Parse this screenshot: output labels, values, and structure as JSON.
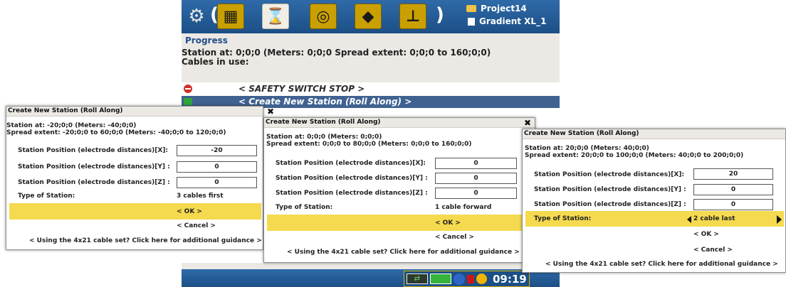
{
  "app": {
    "project_name": "Project14",
    "protocol_name": "Gradient XL_1",
    "progress_title": "Progress",
    "station_line": "Station at: 0;0;0 (Meters: 0;0;0 Spread extent: 0;0;0 to 160;0;0)",
    "cables_line": "Cables in use:",
    "safety_stop_label": "< SAFETY SWITCH STOP >",
    "create_station_label": "< Create New Station (Roll Along) >",
    "clock": "09:19",
    "toolbar_icons": [
      "gear-icon",
      "layers-icon",
      "hourglass-icon",
      "spiral-icon",
      "diamond-icon",
      "crane-icon"
    ]
  },
  "dialogs": [
    {
      "title": "Create New Station (Roll Along)",
      "close": "✖",
      "station_at": "Station at: -20;0;0 (Meters: -40;0;0)",
      "spread_extent": "Spread extent: -20;0;0 to 60;0;0 (Meters: -40;0;0 to 120;0;0)",
      "x_label": "Station Position (electrode distances)[X]:",
      "y_label": "Station Position (electrode distances)[Y] :",
      "z_label": "Station Position (electrode distances)[Z] :",
      "x_value": "-20",
      "y_value": "0",
      "z_value": "0",
      "type_label": "Type of Station:",
      "type_value": "3 cables first",
      "ok": "< OK >",
      "cancel": "< Cancel >",
      "guidance": "< Using the 4x21 cable set? Click here for additional guidance >"
    },
    {
      "title": "Create New Station (Roll Along)",
      "close": "✖",
      "station_at": "Station at: 0;0;0 (Meters: 0;0;0)",
      "spread_extent": "Spread extent: 0;0;0 to 80;0;0 (Meters: 0;0;0 to 160;0;0)",
      "x_label": "Station Position (electrode distances)[X]:",
      "y_label": "Station Position (electrode distances)[Y] :",
      "z_label": "Station Position (electrode distances)[Z] :",
      "x_value": "0",
      "y_value": "0",
      "z_value": "0",
      "type_label": "Type of Station:",
      "type_value": "1 cable forward",
      "ok": "< OK >",
      "cancel": "< Cancel >",
      "guidance": "< Using the 4x21 cable set? Click here for additional guidance >"
    },
    {
      "title": "Create New Station (Roll Along)",
      "close": "✖",
      "station_at": "Station at: 20;0;0 (Meters: 40;0;0)",
      "spread_extent": "Spread extent: 20;0;0 to 100;0;0 (Meters: 40;0;0 to 200;0;0)",
      "x_label": "Station Position (electrode distances)[X]:",
      "y_label": "Station Position (electrode distances)[Y] :",
      "z_label": "Station Position (electrode distances)[Z] :",
      "x_value": "20",
      "y_value": "0",
      "z_value": "0",
      "type_label": "Type of Station:",
      "type_value": "2 cable last",
      "ok": "< OK >",
      "cancel": "< Cancel >",
      "guidance": "< Using the 4x21 cable set? Click here for additional guidance >"
    }
  ],
  "colors": {
    "highlight": "#f5da4f",
    "selected_row": "#3f6291",
    "toolbar": "#1c4f86"
  }
}
